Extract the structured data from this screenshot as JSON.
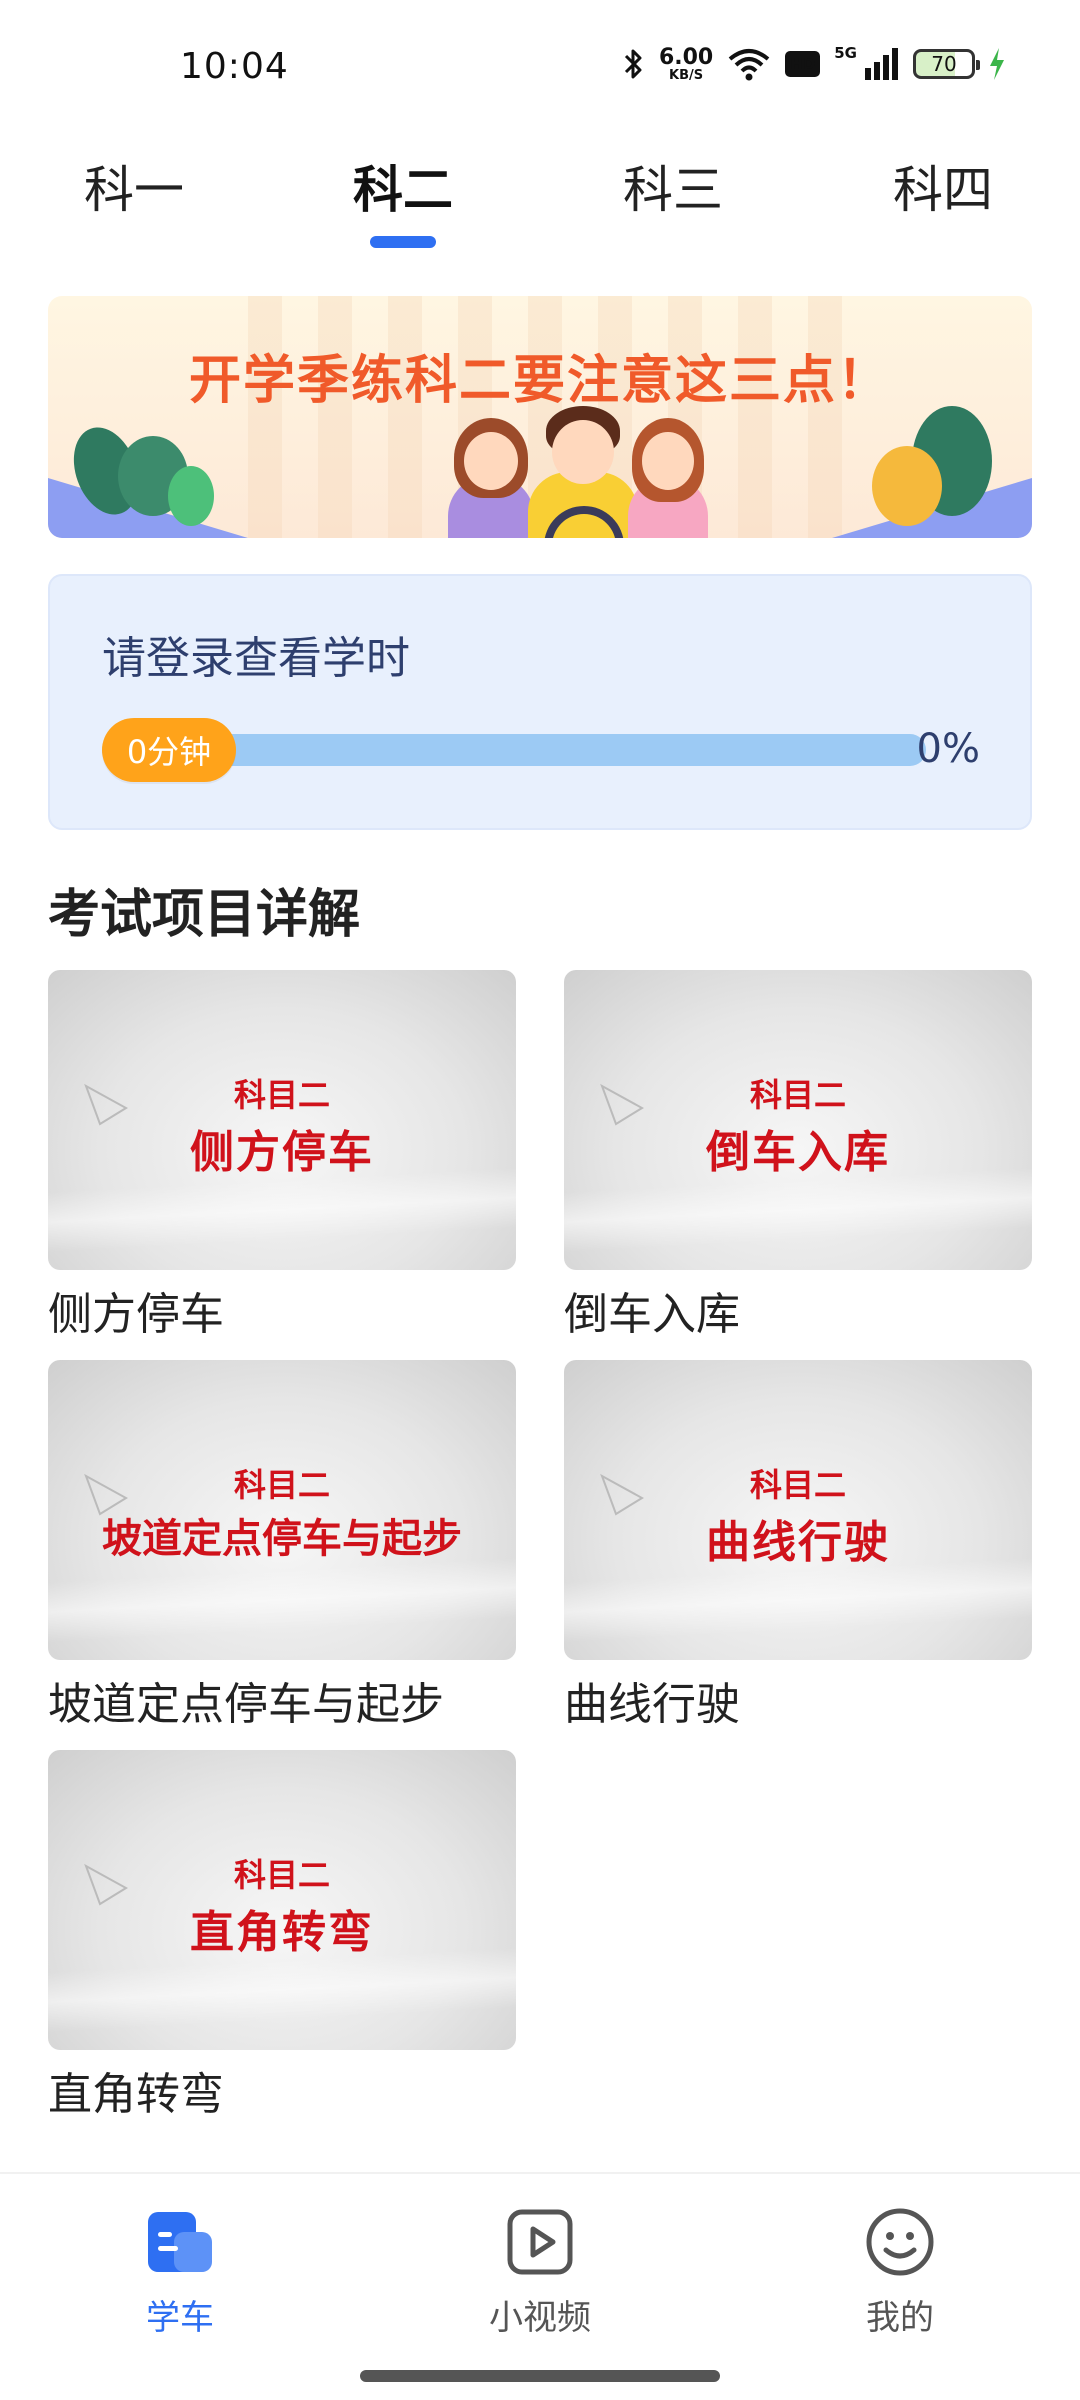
{
  "status_bar": {
    "time": "10:04",
    "net_speed_value": "6.00",
    "net_speed_unit": "KB/S",
    "hd_label": "HD",
    "network_label": "5G",
    "battery_level": "70"
  },
  "tabs": [
    {
      "label": "科一",
      "active": false
    },
    {
      "label": "科二",
      "active": true
    },
    {
      "label": "科三",
      "active": false
    },
    {
      "label": "科四",
      "active": false
    }
  ],
  "banner": {
    "title": "开学季练科二要注意这三点！"
  },
  "study_hours": {
    "title": "请登录查看学时",
    "minutes_chip": "0分钟",
    "percent": "0%",
    "progress_fraction": 0
  },
  "section": {
    "title": "考试项目详解"
  },
  "items": [
    {
      "thumb_sub": "科目二",
      "thumb_main": "侧方停车",
      "label": "侧方停车"
    },
    {
      "thumb_sub": "科目二",
      "thumb_main": "倒车入库",
      "label": "倒车入库"
    },
    {
      "thumb_sub": "科目二",
      "thumb_main": "坡道定点停车与起步",
      "label": "坡道定点停车与起步"
    },
    {
      "thumb_sub": "科目二",
      "thumb_main": "曲线行驶",
      "label": "曲线行驶"
    },
    {
      "thumb_sub": "科目二",
      "thumb_main": "直角转弯",
      "label": "直角转弯"
    }
  ],
  "bottom_nav": [
    {
      "label": "学车",
      "icon": "learn-car-icon",
      "active": true
    },
    {
      "label": "小视频",
      "icon": "video-play-icon",
      "active": false
    },
    {
      "label": "我的",
      "icon": "smiley-profile-icon",
      "active": false
    }
  ],
  "colors": {
    "accent": "#2e6ff2",
    "chip": "#ffa31a",
    "progress_track": "#9ccaf4",
    "card_bg": "#e8f0fd",
    "thumb_text": "#d0121b",
    "banner_title": "#f05a2a"
  }
}
